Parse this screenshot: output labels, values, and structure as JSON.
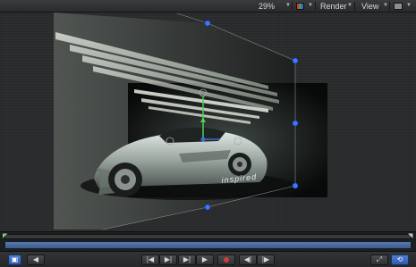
{
  "toolbar": {
    "zoom": "29%",
    "render": "Render",
    "view": "View"
  },
  "canvas": {
    "overlay_text": "inspired"
  },
  "transport": {
    "buttons": [
      {
        "name": "canvas-mode-button",
        "glyph": "▣"
      },
      {
        "name": "prev-button",
        "glyph": "◀"
      },
      {
        "name": "go-to-start-button",
        "glyph": "|◀"
      },
      {
        "name": "play-reverse-button",
        "glyph": "▶|"
      },
      {
        "name": "step-forward-button",
        "glyph": "▶|"
      },
      {
        "name": "play-button",
        "glyph": "▶"
      },
      {
        "name": "record-button",
        "glyph": ""
      },
      {
        "name": "mark-in-button",
        "glyph": "◀|"
      },
      {
        "name": "mark-out-button",
        "glyph": "|▶"
      },
      {
        "name": "fullscreen-button",
        "glyph": "⤢"
      },
      {
        "name": "loop-button",
        "glyph": "⟲"
      }
    ]
  },
  "colors": {
    "accent_blue": "#3f6fd0",
    "handle_blue": "#3e78ff",
    "record_red": "#d23a3a"
  }
}
